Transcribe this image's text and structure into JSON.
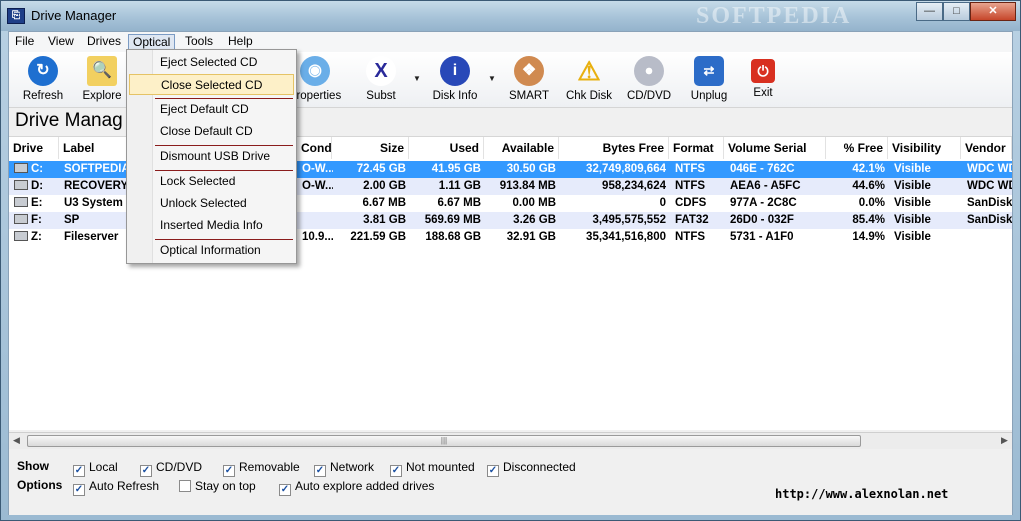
{
  "window": {
    "title": "Drive Manager",
    "watermark": "SOFTPEDIA",
    "minimize": "—",
    "maximize": "□",
    "close": "✕"
  },
  "menubar": {
    "items": [
      "File",
      "View",
      "Drives",
      "Optical",
      "Tools",
      "Help"
    ]
  },
  "toolbar": {
    "buttons": [
      {
        "label": "Refresh",
        "icon": "refresh-icon",
        "color": "#1e6fd0"
      },
      {
        "label": "Explore",
        "icon": "explore-icon",
        "color": "#e8b830"
      },
      {
        "label": "Properties",
        "icon": "properties-icon",
        "color": "#4a9be0"
      },
      {
        "label": "Subst",
        "icon": "subst-icon",
        "color": "#2a2a9a"
      },
      {
        "label": "Disk Info",
        "icon": "info-icon",
        "color": "#2848b8"
      },
      {
        "label": "SMART",
        "icon": "brain-icon",
        "color": "#d08a50"
      },
      {
        "label": "Chk Disk",
        "icon": "warning-icon",
        "color": "#f0c020"
      },
      {
        "label": "CD/DVD",
        "icon": "cd-icon",
        "color": "#c8c8d0"
      },
      {
        "label": "Unplug",
        "icon": "unplug-icon",
        "color": "#2c6cc8"
      },
      {
        "label": "Exit",
        "icon": "exit-icon",
        "color": "#d83020"
      }
    ]
  },
  "heading": "Drive Manag",
  "table": {
    "columns": [
      "Drive",
      "Label",
      "...",
      "Conditio...",
      "Size",
      "Used",
      "Available",
      "Bytes Free",
      "Format",
      "Volume Serial",
      "% Free",
      "Visibility",
      "Vendor"
    ],
    "rows": [
      {
        "drive": "C:",
        "label": "SOFTPEDIA",
        "cond": "O-W...",
        "size": "72.45 GB",
        "used": "41.95 GB",
        "avail": "30.50 GB",
        "bytes": "32,749,809,664",
        "format": "NTFS",
        "serial": "046E - 762C",
        "pfree": "42.1%",
        "vis": "Visible",
        "vendor": "WDC WD"
      },
      {
        "drive": "D:",
        "label": "RECOVERY",
        "cond": "O-W...",
        "size": "2.00 GB",
        "used": "1.11 GB",
        "avail": "913.84 MB",
        "bytes": "958,234,624",
        "format": "NTFS",
        "serial": "AEA6 - A5FC",
        "pfree": "44.6%",
        "vis": "Visible",
        "vendor": "WDC WD"
      },
      {
        "drive": "E:",
        "label": "U3 System",
        "cond": "",
        "size": "6.67 MB",
        "used": "6.67 MB",
        "avail": "0.00 MB",
        "bytes": "0",
        "format": "CDFS",
        "serial": "977A - 2C8C",
        "pfree": "0.0%",
        "vis": "Visible",
        "vendor": "SanDisk"
      },
      {
        "drive": "F:",
        "label": "SP",
        "cond": "",
        "size": "3.81 GB",
        "used": "569.69 MB",
        "avail": "3.26 GB",
        "bytes": "3,495,575,552",
        "format": "FAT32",
        "serial": "26D0 - 032F",
        "pfree": "85.4%",
        "vis": "Visible",
        "vendor": "SanDisk"
      },
      {
        "drive": "Z:",
        "label": "Fileserver",
        "cond": "10.9...",
        "size": "221.59 GB",
        "used": "188.68 GB",
        "avail": "32.91 GB",
        "bytes": "35,341,516,800",
        "format": "NTFS",
        "serial": "5731 - A1F0",
        "pfree": "14.9%",
        "vis": "Visible",
        "vendor": ""
      }
    ]
  },
  "options": {
    "show_label": "Show",
    "options_label": "Options",
    "show": [
      {
        "label": "Local",
        "checked": true
      },
      {
        "label": "CD/DVD",
        "checked": true
      },
      {
        "label": "Removable",
        "checked": true
      },
      {
        "label": "Network",
        "checked": true
      },
      {
        "label": "Not mounted",
        "checked": true
      },
      {
        "label": "Disconnected",
        "checked": true
      }
    ],
    "opts": [
      {
        "label": "Auto Refresh",
        "checked": true
      },
      {
        "label": "Stay on top",
        "checked": false
      },
      {
        "label": "Auto explore added drives",
        "checked": true
      }
    ],
    "url": "http://www.alexnolan.net"
  },
  "optical_menu": {
    "items": [
      "Eject Selected CD",
      "Close Selected CD",
      "Eject Default CD",
      "Close Default CD",
      "Dismount USB Drive",
      "Lock Selected",
      "Unlock Selected",
      "Inserted Media Info",
      "Optical Information"
    ],
    "highlighted": "Close Selected CD"
  }
}
